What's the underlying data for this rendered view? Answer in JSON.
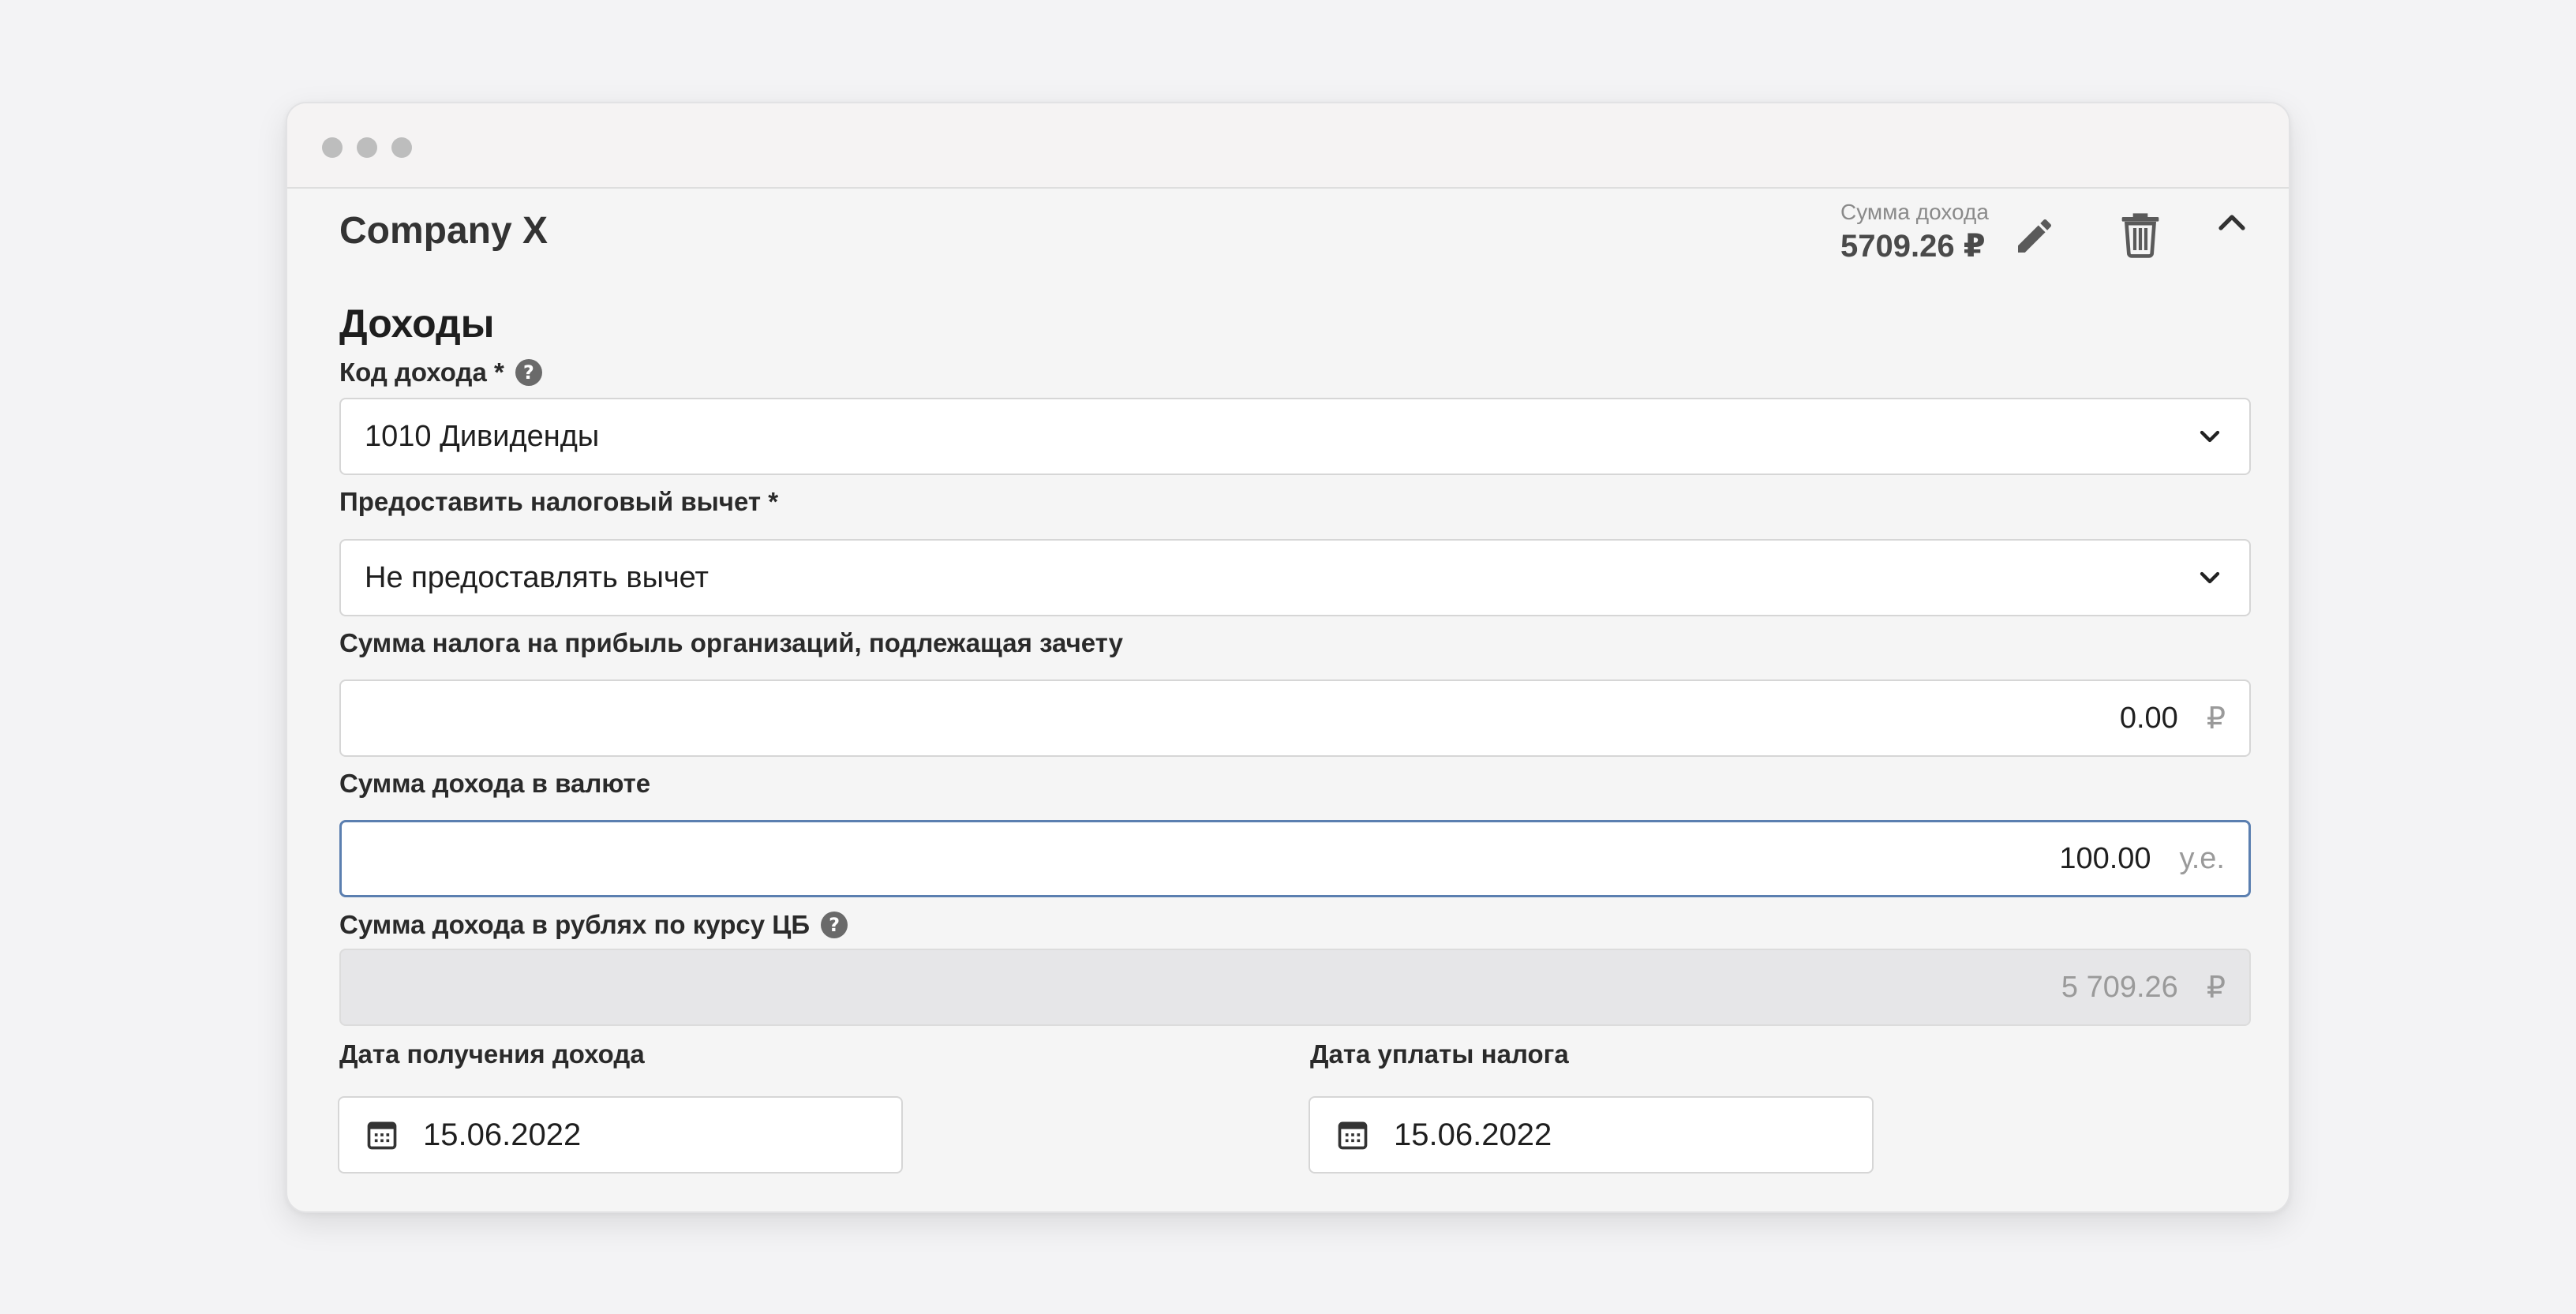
{
  "card": {
    "company": "Company X",
    "sum_label": "Сумма дохода",
    "sum_value": "5709.26 ₽"
  },
  "form": {
    "section_title": "Доходы",
    "income_code": {
      "label": "Код дохода *",
      "value": "1010 Дивиденды"
    },
    "deduction": {
      "label": "Предоставить налоговый вычет *",
      "value": "Не предоставлять вычет"
    },
    "corp_tax": {
      "label": "Сумма налога на прибыль организаций, подлежащая зачету",
      "value": "0.00",
      "unit": "₽"
    },
    "currency_income": {
      "label": "Сумма дохода в валюте",
      "value": "100.00",
      "unit": "у.е."
    },
    "rub_income": {
      "label": "Сумма дохода в рублях по курсу ЦБ",
      "value": "5 709.26",
      "unit": "₽"
    },
    "income_date": {
      "label": "Дата получения дохода",
      "value": "15.06.2022"
    },
    "tax_date": {
      "label": "Дата уплаты налога",
      "value": "15.06.2022"
    }
  },
  "icons": {
    "help": "?"
  }
}
